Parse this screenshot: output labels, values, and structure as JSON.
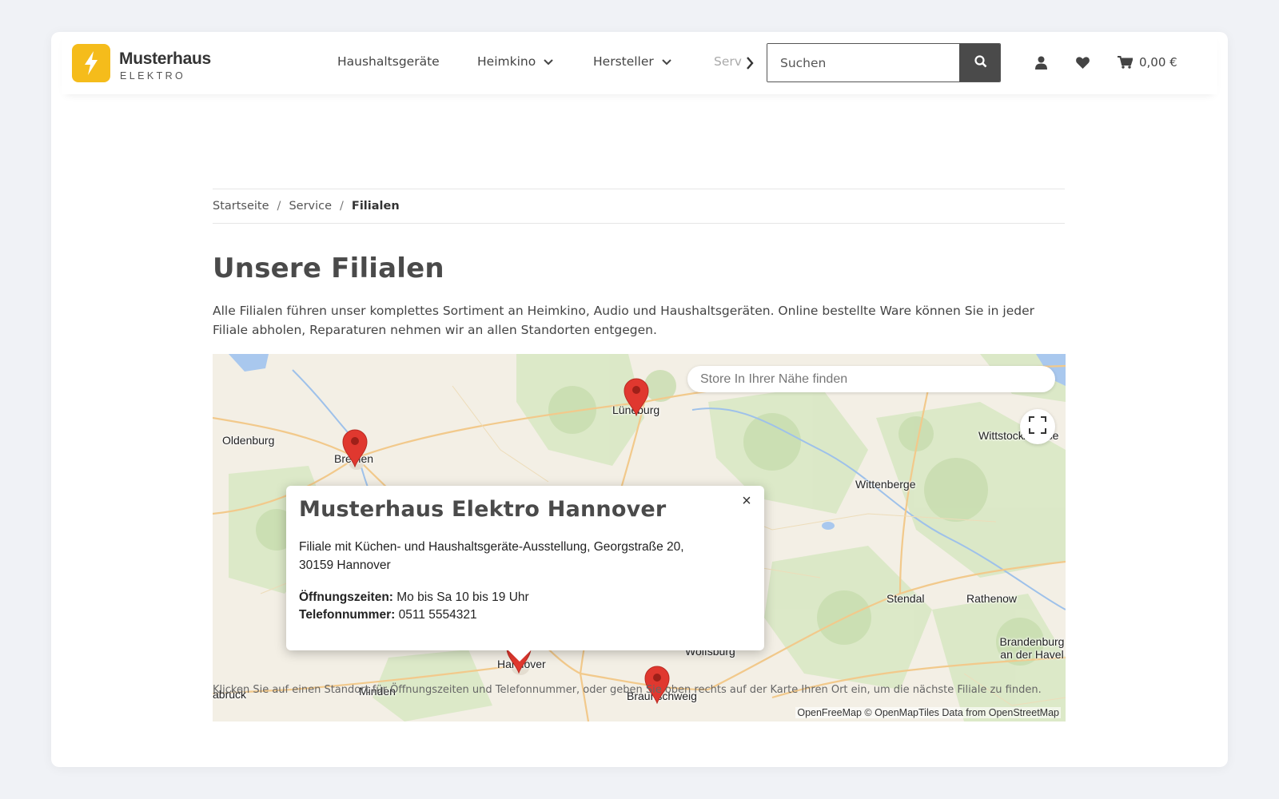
{
  "brand": {
    "name": "Musterhaus",
    "sub": "ELEKTRO",
    "accent": "#f5bc1b"
  },
  "nav": {
    "items": [
      {
        "label": "Haushaltsgeräte"
      },
      {
        "label": "Heimkino"
      },
      {
        "label": "Hersteller"
      },
      {
        "label": "Serv"
      }
    ]
  },
  "search": {
    "placeholder": "Suchen"
  },
  "cart": {
    "total": "0,00 €"
  },
  "breadcrumb": {
    "home": "Startseite",
    "service": "Service",
    "current": "Filialen"
  },
  "page": {
    "title": "Unsere Filialen",
    "intro": "Alle Filialen führen unser komplettes Sortiment an Heimkino, Audio und Haushaltsgeräten. Online bestellte Ware können Sie in jeder Filiale abholen, Reparaturen nehmen wir an allen Standorten entgegen.",
    "map_note": "Klicken Sie auf einen Standort für Öffnungszeiten und Telefonnummer, oder geben Sie oben rechts auf der Karte Ihren Ort ein, um die nächste Filiale zu finden."
  },
  "map": {
    "search_placeholder": "Store In Ihrer Nähe finden",
    "attribution": "OpenFreeMap © OpenMapTiles Data from OpenStreetMap",
    "pin_color": "#e0382f",
    "cities": {
      "oldenburg": "Oldenburg",
      "bremen": "Bremen",
      "lueneburg": "Lüneburg",
      "wittstock": "Wittstock/Dosse",
      "wittenberge": "Wittenberge",
      "stendal": "Stendal",
      "rathenow": "Rathenow",
      "brandenburg": "Brandenburg an der Havel",
      "wolfsburg": "Wolfsburg",
      "hannover": "Hannover",
      "minden": "Minden",
      "osnabrueck": "abrück",
      "braunschweig": "Braunschweig"
    }
  },
  "popup": {
    "title": "Musterhaus Elektro Hannover",
    "desc": "Filiale mit Küchen- und Haushaltsgeräte-Ausstellung, Georgstraße 20, 30159 Hannover",
    "hours_label": "Öffnungszeiten:",
    "hours_value": " Mo bis Sa 10 bis 19 Uhr",
    "phone_label": "Telefonnummer:",
    "phone_value": " 0511 5554321"
  }
}
